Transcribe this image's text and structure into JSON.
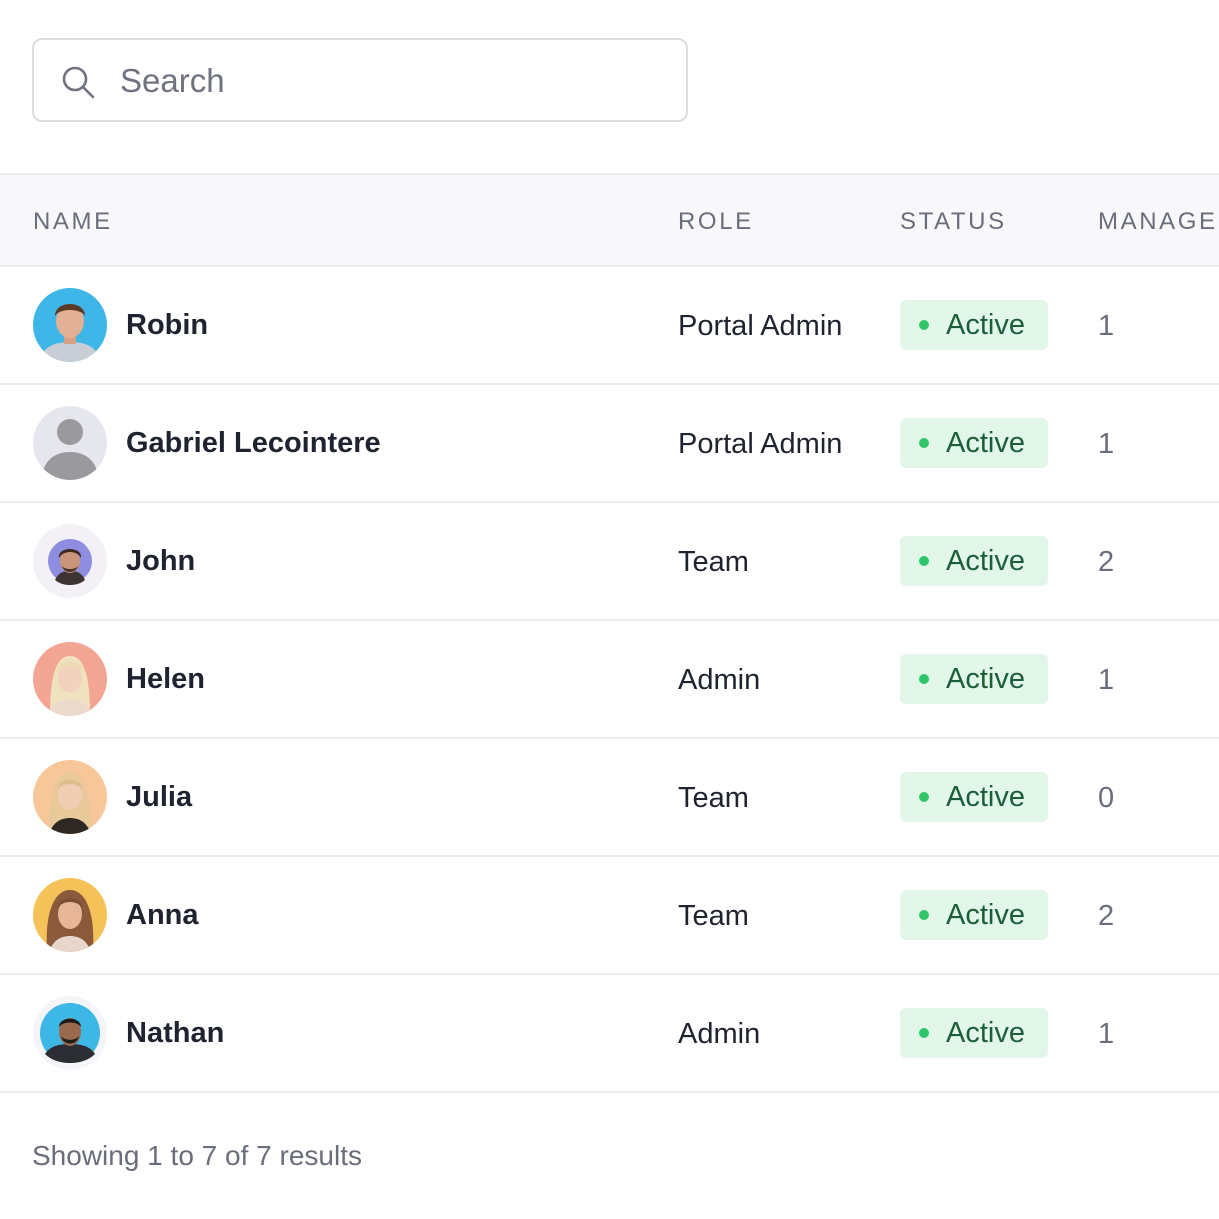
{
  "search": {
    "placeholder": "Search",
    "value": ""
  },
  "table": {
    "columns": [
      "NAME",
      "ROLE",
      "STATUS",
      "MANAGE"
    ],
    "rows": [
      {
        "name": "Robin",
        "role": "Portal Admin",
        "status": "Active",
        "managed": "1",
        "avatar": "photo-man-blue-background"
      },
      {
        "name": "Gabriel Lecointere",
        "role": "Portal Admin",
        "status": "Active",
        "managed": "1",
        "avatar": "default-user-placeholder"
      },
      {
        "name": "John",
        "role": "Team",
        "status": "Active",
        "managed": "2",
        "avatar": "photo-man-purple-background"
      },
      {
        "name": "Helen",
        "role": "Admin",
        "status": "Active",
        "managed": "1",
        "avatar": "photo-woman-coral-background"
      },
      {
        "name": "Julia",
        "role": "Team",
        "status": "Active",
        "managed": "0",
        "avatar": "photo-woman-peach-background"
      },
      {
        "name": "Anna",
        "role": "Team",
        "status": "Active",
        "managed": "2",
        "avatar": "photo-woman-yellow-background"
      },
      {
        "name": "Nathan",
        "role": "Admin",
        "status": "Active",
        "managed": "1",
        "avatar": "photo-man-sky-background"
      }
    ]
  },
  "footer": {
    "results_text": "Showing 1 to 7 of 7 results"
  },
  "colors": {
    "status_active_bg": "#e2f7ea",
    "status_active_dot": "#2fc569",
    "status_active_text": "#1b5f38",
    "header_bg": "#f8f8fb",
    "border": "#ebecf0",
    "muted_text": "#6a6e7c"
  }
}
